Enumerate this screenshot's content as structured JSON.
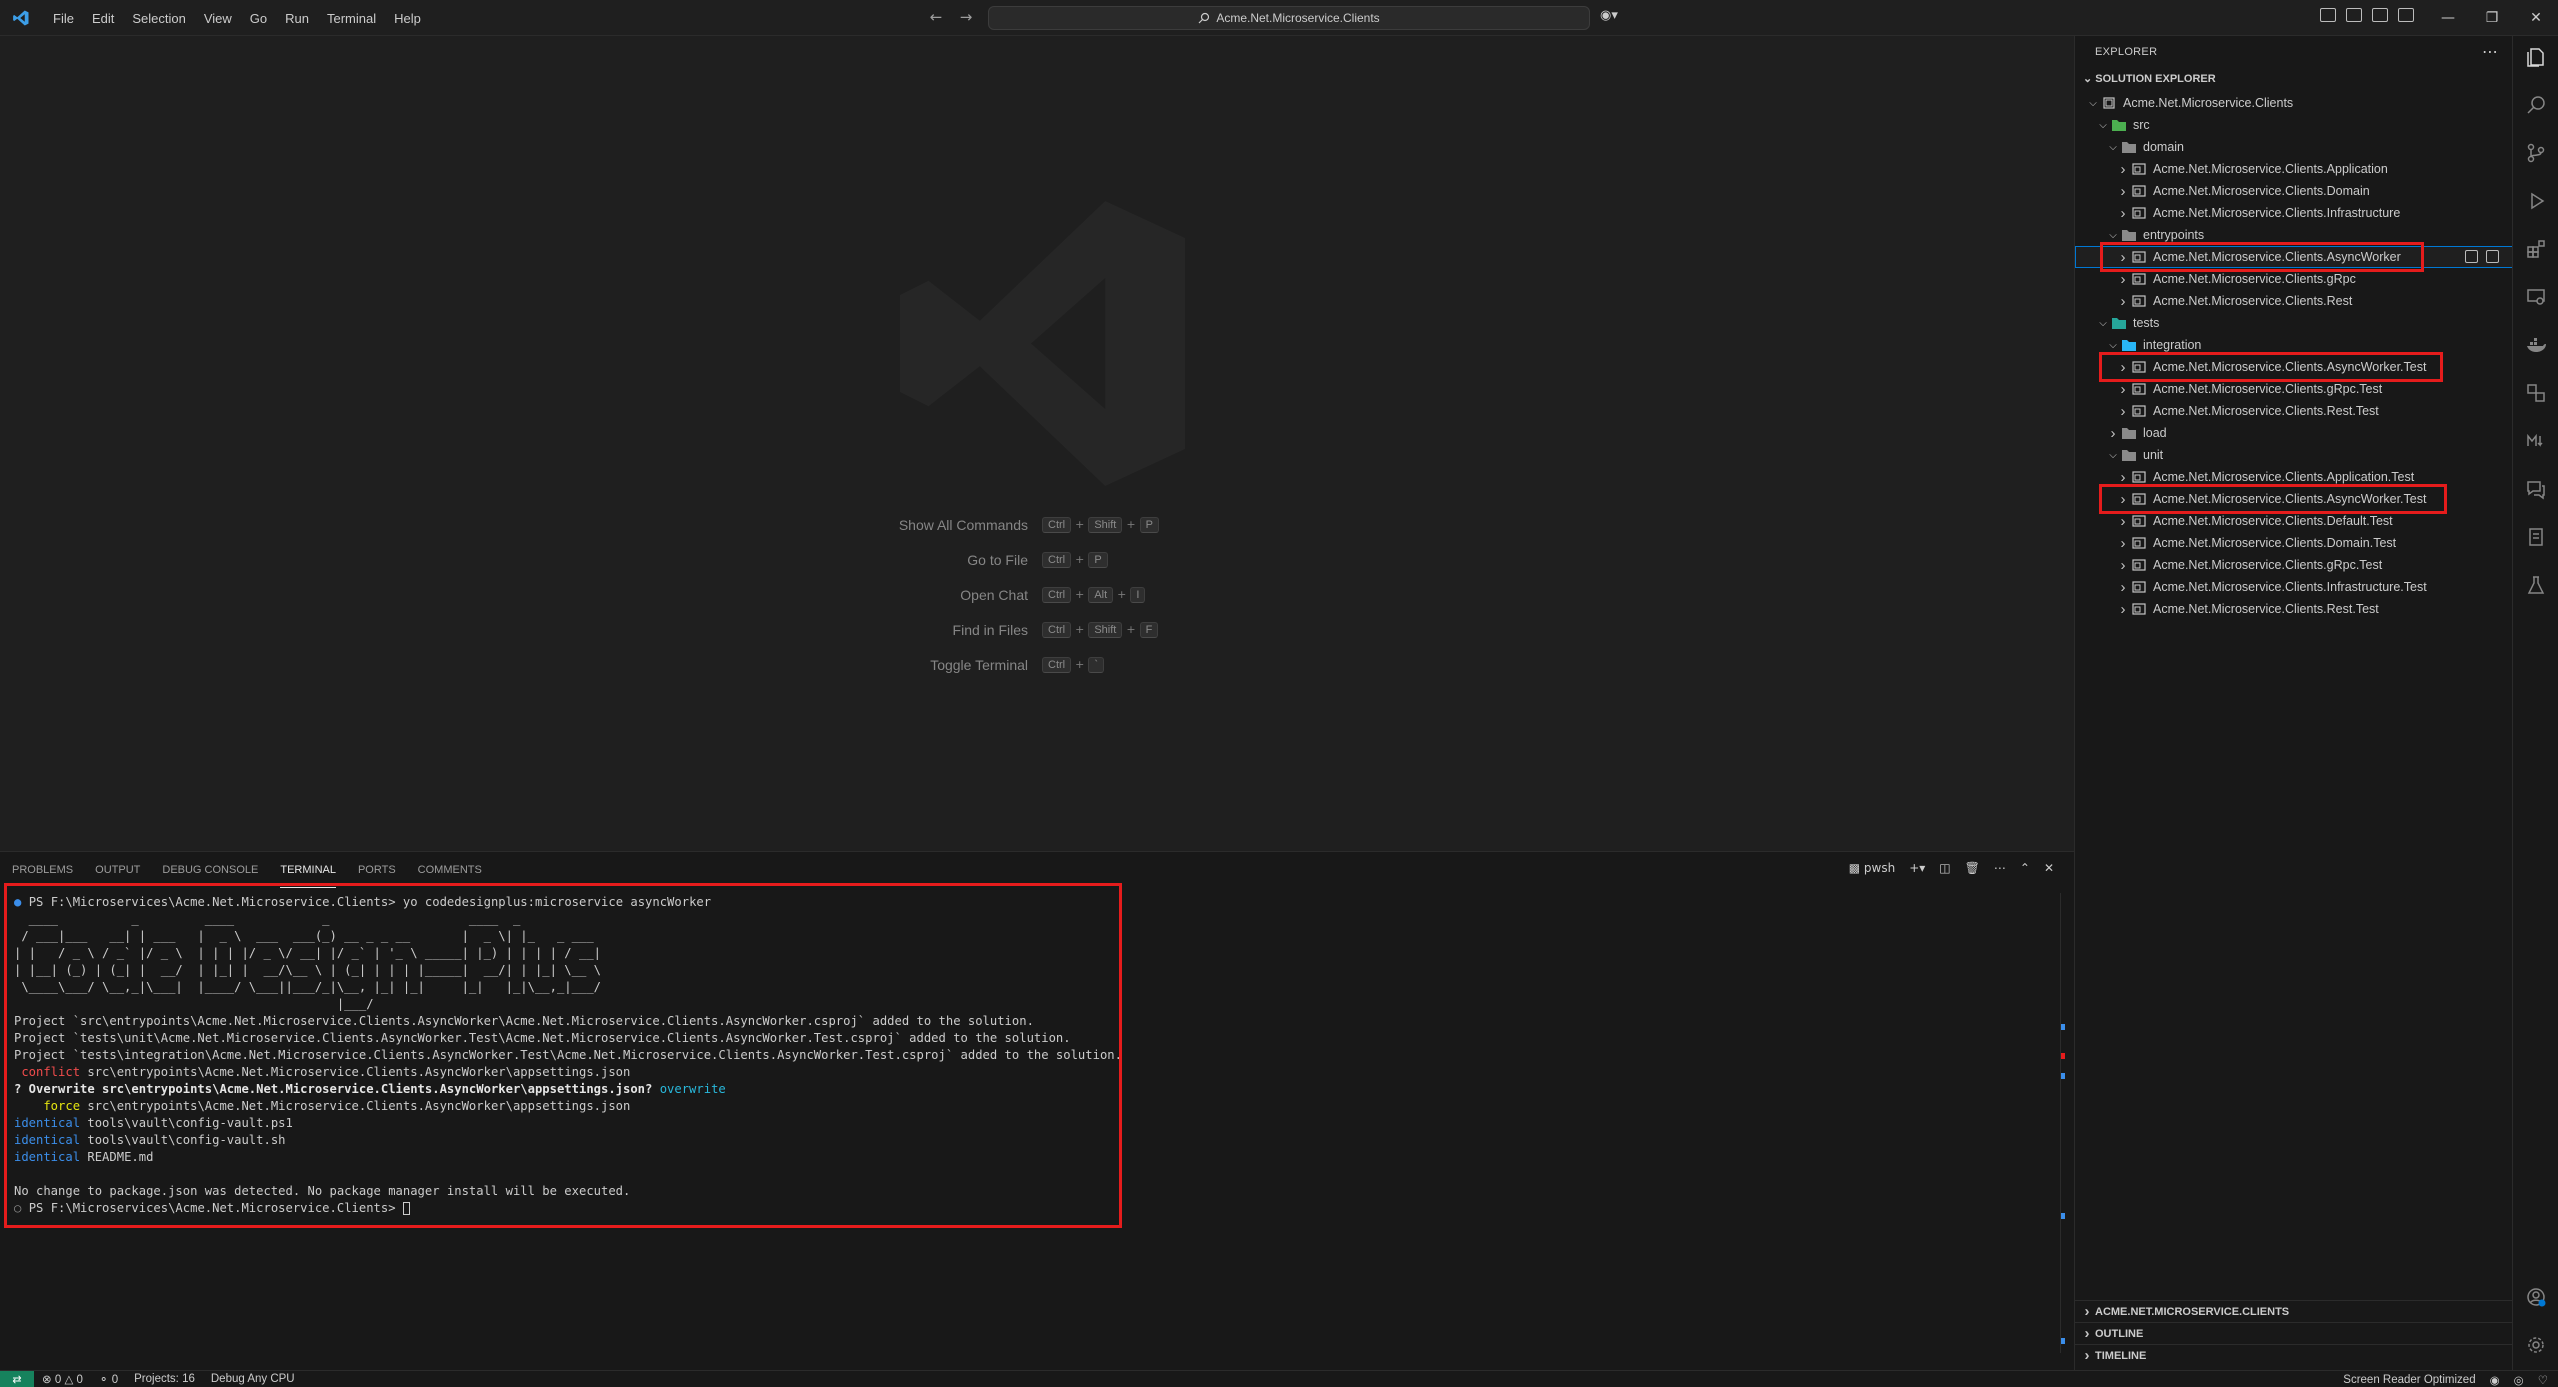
{
  "titlebar": {
    "menu": [
      "File",
      "Edit",
      "Selection",
      "View",
      "Go",
      "Run",
      "Terminal",
      "Help"
    ],
    "command_center": "Acme.Net.Microservice.Clients"
  },
  "editor": {
    "shortcuts": [
      {
        "label": "Show All Commands",
        "keys": [
          "Ctrl",
          "Shift",
          "P"
        ]
      },
      {
        "label": "Go to File",
        "keys": [
          "Ctrl",
          "P"
        ]
      },
      {
        "label": "Open Chat",
        "keys": [
          "Ctrl",
          "Alt",
          "I"
        ]
      },
      {
        "label": "Find in Files",
        "keys": [
          "Ctrl",
          "Shift",
          "F"
        ]
      },
      {
        "label": "Toggle Terminal",
        "keys": [
          "Ctrl",
          "`"
        ]
      }
    ]
  },
  "panel": {
    "tabs": [
      "PROBLEMS",
      "OUTPUT",
      "DEBUG CONSOLE",
      "TERMINAL",
      "PORTS",
      "COMMENTS"
    ],
    "active_tab": "TERMINAL",
    "shell_label": "pwsh",
    "terminal": {
      "prompt_cmd": "PS F:\\Microservices\\Acme.Net.Microservice.Clients> ",
      "command": "yo codedesignplus:microservice asyncWorker",
      "banner": [
        "  ____          _         ____            _                   ____  _",
        " / ___|___   __| | ___   |  _ \\  ___  ___(_) __ _ _ __       |  _ \\| |_   _ ___",
        "| |   / _ \\ / _` |/ _ \\  | | | |/ _ \\/ __| |/ _` | '_ \\ _____| |_) | | | | / __|",
        "| |__| (_) | (_| |  __/  | |_| |  __/\\__ \\ | (_| | | | |_____|  __/| | |_| \\__ \\",
        " \\____\\___/ \\__,_|\\___|  |____/ \\___||___/_|\\__, |_| |_|     |_|   |_|\\__,_|___/",
        "                                            |___/"
      ],
      "lines": [
        "Project `src\\entrypoints\\Acme.Net.Microservice.Clients.AsyncWorker\\Acme.Net.Microservice.Clients.AsyncWorker.csproj` added to the solution.",
        "Project `tests\\unit\\Acme.Net.Microservice.Clients.AsyncWorker.Test\\Acme.Net.Microservice.Clients.AsyncWorker.Test.csproj` added to the solution.",
        "Project `tests\\integration\\Acme.Net.Microservice.Clients.AsyncWorker.Test\\Acme.Net.Microservice.Clients.AsyncWorker.Test.csproj` added to the solution."
      ],
      "conflict_tag": " conflict",
      "conflict_path": " src\\entrypoints\\Acme.Net.Microservice.Clients.AsyncWorker\\appsettings.json",
      "overwrite_q": "? Overwrite src\\entrypoints\\Acme.Net.Microservice.Clients.AsyncWorker\\appsettings.json?",
      "overwrite_ans": " overwrite",
      "force_tag": "    force",
      "force_path": " src\\entrypoints\\Acme.Net.Microservice.Clients.AsyncWorker\\appsettings.json",
      "identical": [
        {
          "tag": "identical",
          "path": " tools\\vault\\config-vault.ps1"
        },
        {
          "tag": "identical",
          "path": " tools\\vault\\config-vault.sh"
        },
        {
          "tag": "identical",
          "path": " README.md"
        }
      ],
      "final_msg": "No change to package.json was detected. No package manager install will be executed.",
      "final_prompt": "PS F:\\Microservices\\Acme.Net.Microservice.Clients> "
    }
  },
  "sidebar": {
    "header": "EXPLORER",
    "solution_header": "SOLUTION EXPLORER",
    "tree": [
      {
        "label": "Acme.Net.Microservice.Clients",
        "depth": 0,
        "open": true,
        "icon": "solution-icon"
      },
      {
        "label": "src",
        "depth": 1,
        "open": true,
        "icon": "folder-src-icon"
      },
      {
        "label": "domain",
        "depth": 2,
        "open": true,
        "icon": "folder-icon"
      },
      {
        "label": "Acme.Net.Microservice.Clients.Application",
        "depth": 3,
        "open": false,
        "icon": "project-icon"
      },
      {
        "label": "Acme.Net.Microservice.Clients.Domain",
        "depth": 3,
        "open": false,
        "icon": "project-icon"
      },
      {
        "label": "Acme.Net.Microservice.Clients.Infrastructure",
        "depth": 3,
        "open": false,
        "icon": "project-icon"
      },
      {
        "label": "entrypoints",
        "depth": 2,
        "open": true,
        "icon": "folder-icon"
      },
      {
        "label": "Acme.Net.Microservice.Clients.AsyncWorker",
        "depth": 3,
        "open": false,
        "icon": "project-icon",
        "selected": true
      },
      {
        "label": "Acme.Net.Microservice.Clients.gRpc",
        "depth": 3,
        "open": false,
        "icon": "project-icon"
      },
      {
        "label": "Acme.Net.Microservice.Clients.Rest",
        "depth": 3,
        "open": false,
        "icon": "project-icon"
      },
      {
        "label": "tests",
        "depth": 1,
        "open": true,
        "icon": "folder-test-icon"
      },
      {
        "label": "integration",
        "depth": 2,
        "open": true,
        "icon": "folder-integration-icon"
      },
      {
        "label": "Acme.Net.Microservice.Clients.AsyncWorker.Test",
        "depth": 3,
        "open": false,
        "icon": "project-icon"
      },
      {
        "label": "Acme.Net.Microservice.Clients.gRpc.Test",
        "depth": 3,
        "open": false,
        "icon": "project-icon"
      },
      {
        "label": "Acme.Net.Microservice.Clients.Rest.Test",
        "depth": 3,
        "open": false,
        "icon": "project-icon"
      },
      {
        "label": "load",
        "depth": 2,
        "open": false,
        "icon": "folder-icon"
      },
      {
        "label": "unit",
        "depth": 2,
        "open": true,
        "icon": "folder-icon"
      },
      {
        "label": "Acme.Net.Microservice.Clients.Application.Test",
        "depth": 3,
        "open": false,
        "icon": "project-icon"
      },
      {
        "label": "Acme.Net.Microservice.Clients.AsyncWorker.Test",
        "depth": 3,
        "open": false,
        "icon": "project-icon"
      },
      {
        "label": "Acme.Net.Microservice.Clients.Default.Test",
        "depth": 3,
        "open": false,
        "icon": "project-icon"
      },
      {
        "label": "Acme.Net.Microservice.Clients.Domain.Test",
        "depth": 3,
        "open": false,
        "icon": "project-icon"
      },
      {
        "label": "Acme.Net.Microservice.Clients.gRpc.Test",
        "depth": 3,
        "open": false,
        "icon": "project-icon"
      },
      {
        "label": "Acme.Net.Microservice.Clients.Infrastructure.Test",
        "depth": 3,
        "open": false,
        "icon": "project-icon"
      },
      {
        "label": "Acme.Net.Microservice.Clients.Rest.Test",
        "depth": 3,
        "open": false,
        "icon": "project-icon"
      }
    ],
    "sections": [
      "ACME.NET.MICROSERVICE.CLIENTS",
      "OUTLINE",
      "TIMELINE"
    ]
  },
  "statusbar": {
    "errors": "0",
    "warnings": "0",
    "ports": "0",
    "projects": "Projects: 16",
    "config": "Debug Any CPU",
    "screen_reader": "Screen Reader Optimized"
  },
  "colors": {
    "accent": "#0078d4",
    "highlight": "#e51c1c",
    "remote": "#16825d"
  }
}
